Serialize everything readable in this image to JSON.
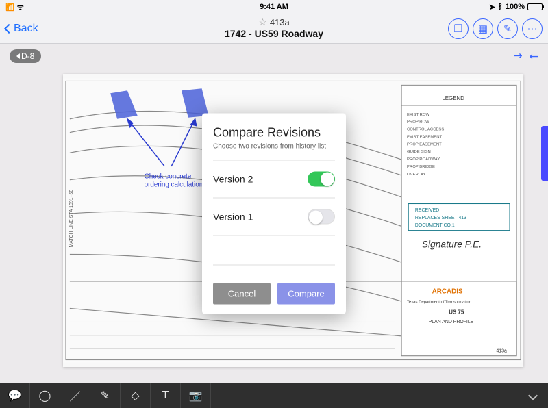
{
  "statusbar": {
    "carrier_icon": "signal-icon",
    "wifi_icon": "wifi-icon",
    "time": "9:41 AM",
    "location_icon": "location-icon",
    "bluetooth_icon": "bluetooth-icon",
    "battery_pct": "100%"
  },
  "nav": {
    "back_label": "Back",
    "title_line1": "413a",
    "title_line2": "1742 - US59 Roadway",
    "right_icons": [
      "layers-icon",
      "grid-icon",
      "pencil-square-icon",
      "more-icon"
    ]
  },
  "badge": {
    "label": "D-8"
  },
  "blueprint": {
    "annotation": "Check concrete ordering calculation",
    "title_block": {
      "company": "ARCADIS",
      "agency": "Texas Department of Transportation",
      "route": "US 75",
      "sheet_title": "PLAN AND PROFILE",
      "sheet_no": "413a"
    },
    "stamp": {
      "received": "RECEIVED",
      "replaces": "REPLACES SHEET  413",
      "document": "DOCUMENT  CO.1"
    }
  },
  "modal": {
    "title": "Compare Revisions",
    "subtitle": "Choose two revisions from history list",
    "versions": [
      {
        "label": "Version 2",
        "on": true
      },
      {
        "label": "Version 1",
        "on": false
      }
    ],
    "cancel_label": "Cancel",
    "compare_label": "Compare"
  },
  "toolbar": {
    "tools": [
      "speech-bubble-icon",
      "circle-icon",
      "line-icon",
      "pencil-icon",
      "eraser-icon",
      "text-icon",
      "camera-icon"
    ]
  }
}
